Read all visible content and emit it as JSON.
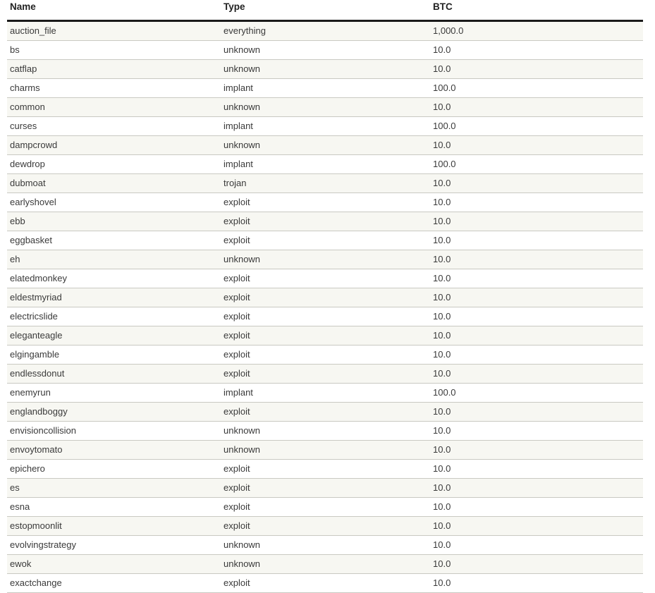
{
  "table": {
    "columns": [
      {
        "key": "name",
        "label": "Name"
      },
      {
        "key": "type",
        "label": "Type"
      },
      {
        "key": "btc",
        "label": "BTC"
      }
    ],
    "rows": [
      {
        "name": "auction_file",
        "type": "everything",
        "btc": "1,000.0"
      },
      {
        "name": "bs",
        "type": "unknown",
        "btc": "10.0"
      },
      {
        "name": "catflap",
        "type": "unknown",
        "btc": "10.0"
      },
      {
        "name": "charms",
        "type": "implant",
        "btc": "100.0"
      },
      {
        "name": "common",
        "type": "unknown",
        "btc": "10.0"
      },
      {
        "name": "curses",
        "type": "implant",
        "btc": "100.0"
      },
      {
        "name": "dampcrowd",
        "type": "unknown",
        "btc": "10.0"
      },
      {
        "name": "dewdrop",
        "type": "implant",
        "btc": "100.0"
      },
      {
        "name": "dubmoat",
        "type": "trojan",
        "btc": "10.0"
      },
      {
        "name": "earlyshovel",
        "type": "exploit",
        "btc": "10.0"
      },
      {
        "name": "ebb",
        "type": "exploit",
        "btc": "10.0"
      },
      {
        "name": "eggbasket",
        "type": "exploit",
        "btc": "10.0"
      },
      {
        "name": "eh",
        "type": "unknown",
        "btc": "10.0"
      },
      {
        "name": "elatedmonkey",
        "type": "exploit",
        "btc": "10.0"
      },
      {
        "name": "eldestmyriad",
        "type": "exploit",
        "btc": "10.0"
      },
      {
        "name": "electricslide",
        "type": "exploit",
        "btc": "10.0"
      },
      {
        "name": "eleganteagle",
        "type": "exploit",
        "btc": "10.0"
      },
      {
        "name": "elgingamble",
        "type": "exploit",
        "btc": "10.0"
      },
      {
        "name": "endlessdonut",
        "type": "exploit",
        "btc": "10.0"
      },
      {
        "name": "enemyrun",
        "type": "implant",
        "btc": "100.0"
      },
      {
        "name": "englandboggy",
        "type": "exploit",
        "btc": "10.0"
      },
      {
        "name": "envisioncollision",
        "type": "unknown",
        "btc": "10.0"
      },
      {
        "name": "envoytomato",
        "type": "unknown",
        "btc": "10.0"
      },
      {
        "name": "epichero",
        "type": "exploit",
        "btc": "10.0"
      },
      {
        "name": "es",
        "type": "exploit",
        "btc": "10.0"
      },
      {
        "name": "esna",
        "type": "exploit",
        "btc": "10.0"
      },
      {
        "name": "estopmoonlit",
        "type": "exploit",
        "btc": "10.0"
      },
      {
        "name": "evolvingstrategy",
        "type": "unknown",
        "btc": "10.0"
      },
      {
        "name": "ewok",
        "type": "unknown",
        "btc": "10.0"
      },
      {
        "name": "exactchange",
        "type": "exploit",
        "btc": "10.0"
      }
    ]
  },
  "colors": {
    "page_background": "#ffffff",
    "row_stripe": "#f7f7f2",
    "row_border": "#c9c9c2",
    "header_rule": "#1a1a1a",
    "header_text": "#222222",
    "cell_text": "#3a3a3a"
  }
}
